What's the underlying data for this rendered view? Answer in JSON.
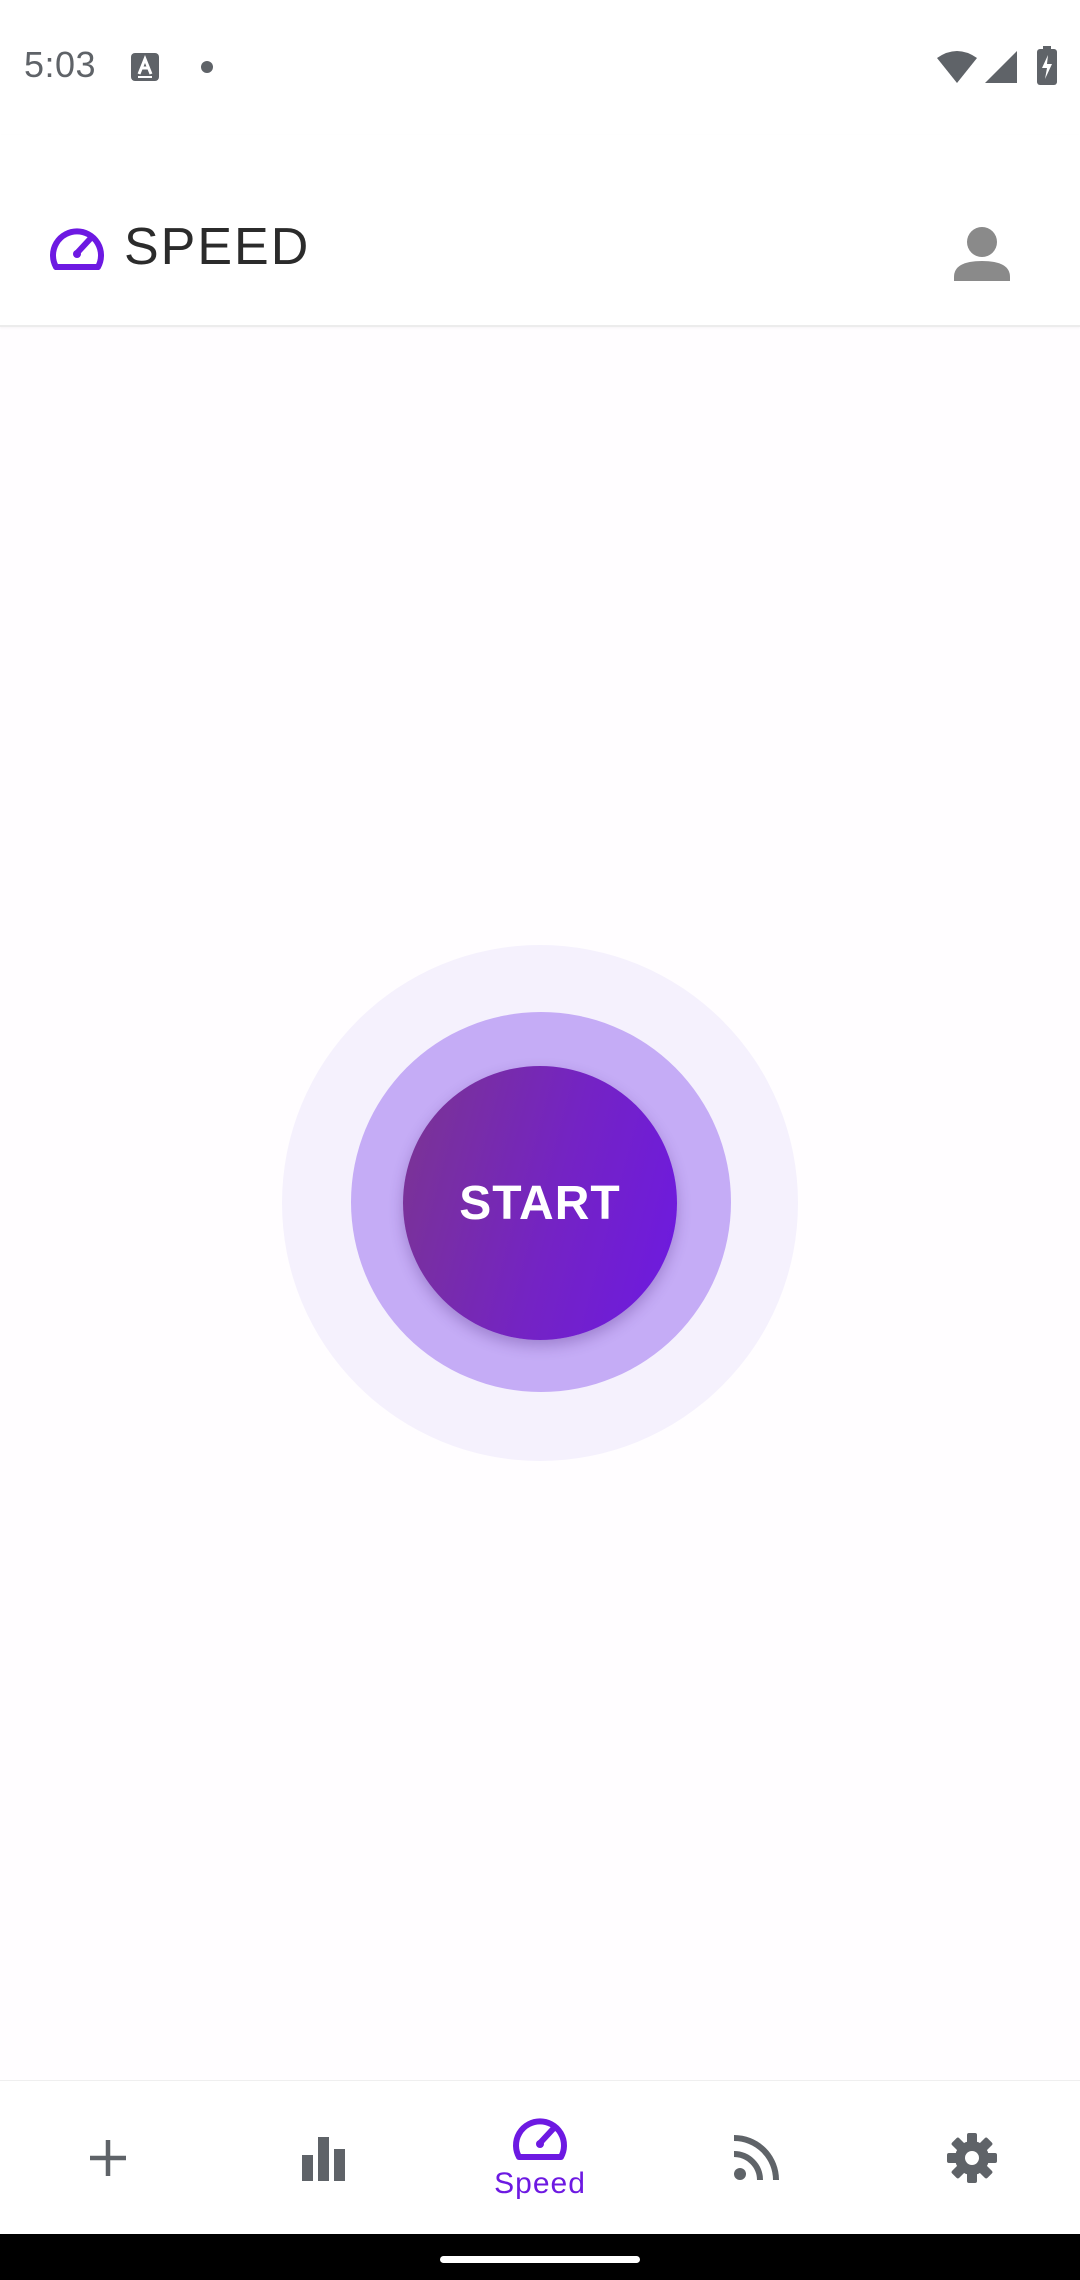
{
  "status_bar": {
    "time": "5:03",
    "icons": [
      "keyboard-a-icon",
      "notification-dot-icon",
      "wifi-icon",
      "signal-icon",
      "battery-charging-icon"
    ]
  },
  "app_bar": {
    "title": "SPEED",
    "logo_icon": "speedometer-icon",
    "profile_icon": "person-icon"
  },
  "start_button": {
    "label": "START"
  },
  "bottom_nav": {
    "items": [
      {
        "icon": "plus-icon",
        "label": "",
        "active": false
      },
      {
        "icon": "bar-chart-icon",
        "label": "",
        "active": false
      },
      {
        "icon": "speedometer-icon",
        "label": "Speed",
        "active": true
      },
      {
        "icon": "rss-feed-icon",
        "label": "",
        "active": false
      },
      {
        "icon": "gear-icon",
        "label": "",
        "active": false
      }
    ]
  },
  "colors": {
    "accent": "#6d19e2",
    "start_gradient_from": "#7b3590",
    "start_gradient_to": "#6d19e2",
    "ring_mid": "#c5acf6",
    "ring_outer": "#f5f1fd",
    "icon_gray": "#5f6368"
  }
}
